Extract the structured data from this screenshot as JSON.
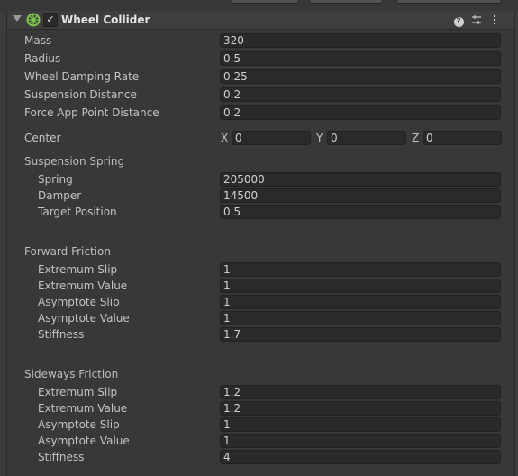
{
  "component": {
    "title": "Wheel Collider",
    "enabled_check": "✓",
    "fold_icon": "foldout-open-icon",
    "component_icon": "wheel-collider-icon",
    "header_icons": [
      "help-icon",
      "presets-icon",
      "more-menu-icon"
    ],
    "colors": {
      "icon_green": "#7ec850",
      "field_bg": "#2a2a2a",
      "panel_bg": "#383838"
    }
  },
  "fields": {
    "mass": {
      "label": "Mass",
      "value": "320"
    },
    "radius": {
      "label": "Radius",
      "value": "0.5"
    },
    "wheel_damping_rate": {
      "label": "Wheel Damping Rate",
      "value": "0.25"
    },
    "suspension_distance": {
      "label": "Suspension Distance",
      "value": "0.2"
    },
    "force_app_point_distance": {
      "label": "Force App Point Distance",
      "value": "0.2"
    }
  },
  "center": {
    "label": "Center",
    "x_label": "X",
    "x": "0",
    "y_label": "Y",
    "y": "0",
    "z_label": "Z",
    "z": "0"
  },
  "suspension_spring": {
    "label": "Suspension Spring",
    "spring": {
      "label": "Spring",
      "value": "205000"
    },
    "damper": {
      "label": "Damper",
      "value": "14500"
    },
    "target_position": {
      "label": "Target Position",
      "value": "0.5"
    }
  },
  "forward_friction": {
    "label": "Forward Friction",
    "extremum_slip": {
      "label": "Extremum Slip",
      "value": "1"
    },
    "extremum_value": {
      "label": "Extremum Value",
      "value": "1"
    },
    "asymptote_slip": {
      "label": "Asymptote Slip",
      "value": "1"
    },
    "asymptote_value": {
      "label": "Asymptote Value",
      "value": "1"
    },
    "stiffness": {
      "label": "Stiffness",
      "value": "1.7"
    }
  },
  "sideways_friction": {
    "label": "Sideways Friction",
    "extremum_slip": {
      "label": "Extremum Slip",
      "value": "1.2"
    },
    "extremum_value": {
      "label": "Extremum Value",
      "value": "1.2"
    },
    "asymptote_slip": {
      "label": "Asymptote Slip",
      "value": "1"
    },
    "asymptote_value": {
      "label": "Asymptote Value",
      "value": "1"
    },
    "stiffness": {
      "label": "Stiffness",
      "value": "4"
    }
  }
}
